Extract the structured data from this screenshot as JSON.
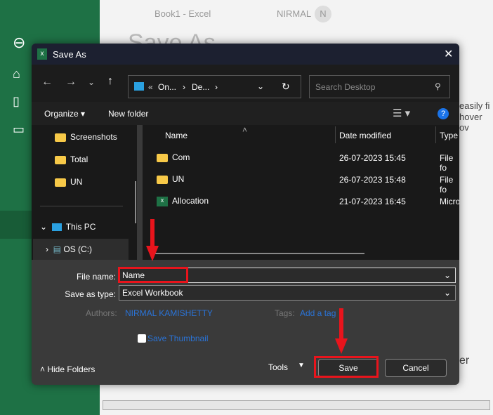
{
  "excel": {
    "title": "Book1 - Excel",
    "user": "NIRMAL",
    "avatar": "N",
    "heading": "Save As",
    "side_text_1": "easily fi",
    "side_text_2": "hover ov",
    "side_text_3": "er"
  },
  "dialog": {
    "title": "Save As",
    "breadcrumb": [
      "On...",
      "De..."
    ],
    "search_placeholder": "Search Desktop",
    "toolbar": {
      "organize": "Organize",
      "new_folder": "New folder"
    },
    "nav_pane": [
      {
        "label": "Screenshots"
      },
      {
        "label": "Total"
      },
      {
        "label": "UN"
      },
      {
        "label": "This PC"
      },
      {
        "label": "OS (C:)"
      }
    ],
    "columns": [
      "Name",
      "Date modified",
      "Type"
    ],
    "files": [
      {
        "name": "Com",
        "date": "26-07-2023 15:45",
        "type": "File fo",
        "kind": "folder"
      },
      {
        "name": "UN",
        "date": "26-07-2023 15:48",
        "type": "File fo",
        "kind": "folder"
      },
      {
        "name": "Allocation",
        "date": "21-07-2023 16:45",
        "type": "Micro",
        "kind": "excel"
      }
    ],
    "file_name_label": "File name:",
    "file_name": "Name",
    "type_label": "Save as type:",
    "type_value": "Excel Workbook",
    "authors_label": "Authors:",
    "authors": "NIRMAL KAMISHETTY",
    "tags_label": "Tags:",
    "tags": "Add a tag",
    "thumbnail": "Save Thumbnail",
    "hide_folders": "Hide Folders",
    "tools": "Tools",
    "save": "Save",
    "cancel": "Cancel"
  },
  "colors": {
    "excel_green": "#1e7145",
    "annotation": "#e8141c"
  }
}
